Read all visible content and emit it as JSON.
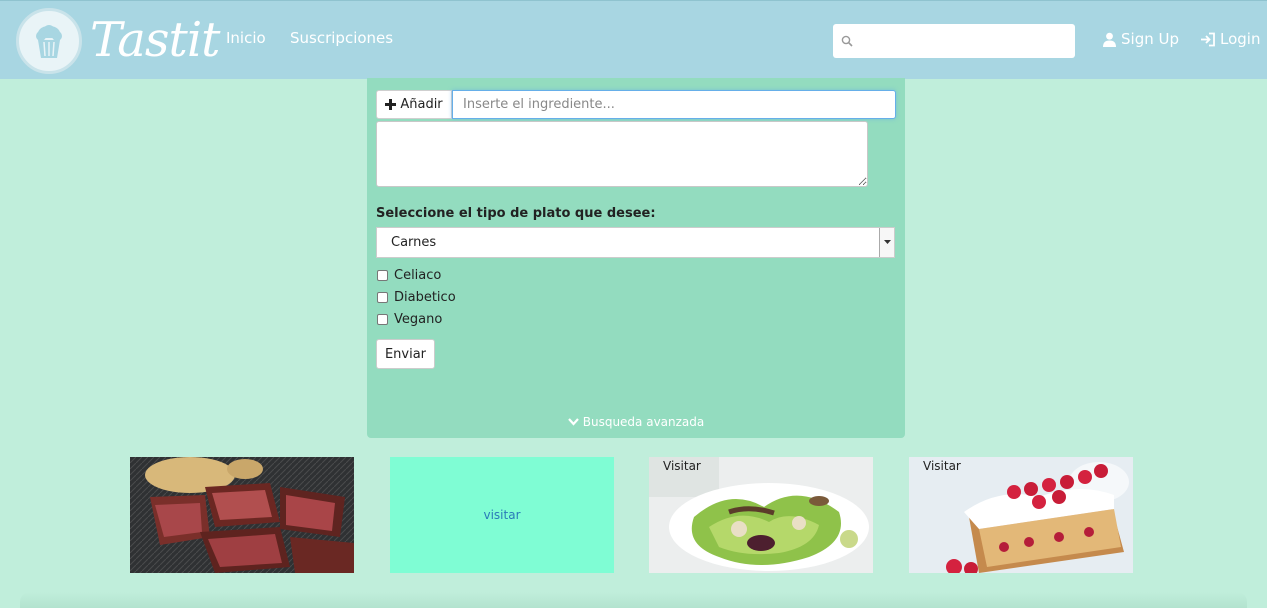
{
  "header": {
    "logo_text": "Tastit",
    "nav": [
      "Inicio",
      "Suscripciones"
    ],
    "search_placeholder": "",
    "signup_label": "Sign Up",
    "login_label": "Login"
  },
  "form": {
    "add_label": "Añadir",
    "ingredient_placeholder": "Inserte el ingrediente...",
    "dish_type_label": "Seleccione el tipo de plato que desee:",
    "dish_type_selected": "Carnes",
    "options": [
      "Celiaco",
      "Diabetico",
      "Vegano"
    ],
    "submit_label": "Enviar",
    "advanced_label": "Busqueda avanzada"
  },
  "cards": [
    {
      "label": ""
    },
    {
      "label": "visitar"
    },
    {
      "label": "Visitar"
    },
    {
      "label": "Visitar"
    }
  ],
  "colors": {
    "background": "#c0eedb",
    "header": "#a8d6e2",
    "panel": "#93dcbf",
    "teal_card": "#7ffdd4"
  }
}
